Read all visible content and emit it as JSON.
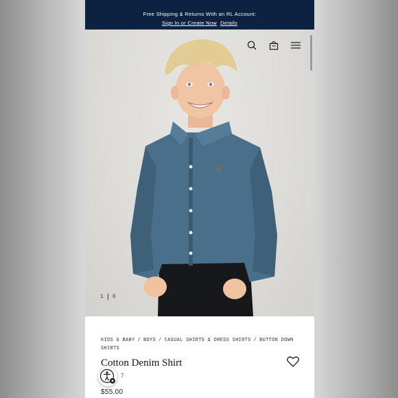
{
  "promo": {
    "message": "Free Shipping & Returns With an RL Account:",
    "signin_link": "Sign In or Create Now",
    "details_link": "Details"
  },
  "header_icons": [
    "search-icon",
    "shopping-bag-icon",
    "menu-icon"
  ],
  "gallery": {
    "current": "1",
    "total": "6"
  },
  "breadcrumb": [
    "KIDS & BABY",
    "BOYS",
    "CASUAL SHIRTS & DRESS SHIRTS",
    "BUTTON DOWN SHIRTS"
  ],
  "product": {
    "title": "Cotton Denim Shirt",
    "style_partial": "7",
    "price": "$55.00"
  },
  "colors": {
    "promo_bg": "#0b2340",
    "shirt": "#4a6f8a",
    "hair": "#e3cc93"
  }
}
